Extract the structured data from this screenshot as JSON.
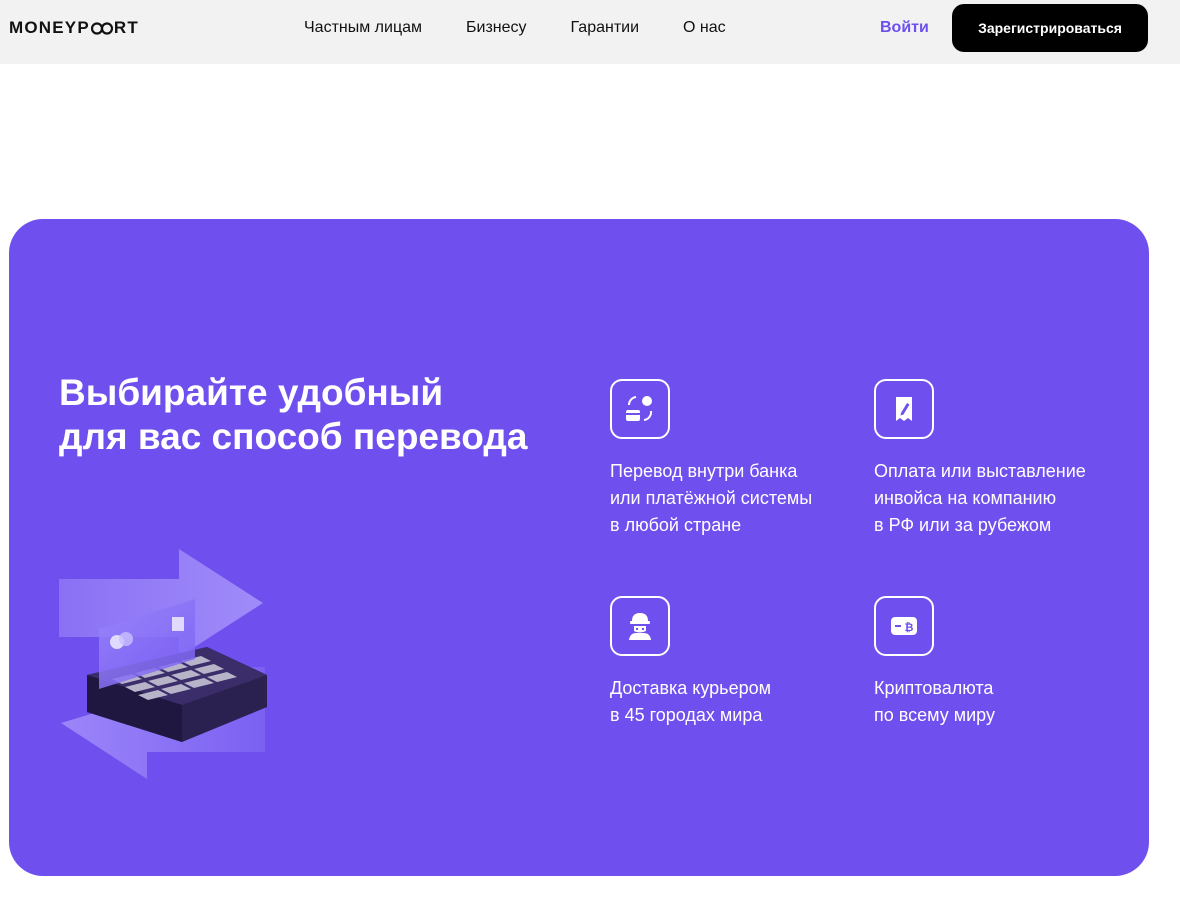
{
  "header": {
    "logo_left": "MONEYP",
    "logo_right": "RT",
    "nav": [
      "Частным лицам",
      "Бизнесу",
      "Гарантии",
      "О нас"
    ],
    "login_label": "Войти",
    "register_label": "Зарегистрироваться"
  },
  "hero": {
    "headline_line1": "Выбирайте удобный",
    "headline_line2": "для вас способ перевода"
  },
  "features": [
    {
      "icon": "bank-transfer-icon",
      "lines": [
        "Перевод внутри банка",
        "или платёжной системы",
        "в любой стране"
      ]
    },
    {
      "icon": "invoice-icon",
      "lines": [
        "Оплата или выставление",
        "инвойса на компанию",
        "в РФ или за рубежом"
      ]
    },
    {
      "icon": "courier-icon",
      "lines": [
        "Доставка курьером",
        "в 45 городах мира"
      ]
    },
    {
      "icon": "crypto-icon",
      "lines": [
        "Криптовалюта",
        "по всему миру"
      ]
    }
  ],
  "colors": {
    "accent": "#6f4fee",
    "login": "#6e4ff0",
    "header_bg": "#f2f2f2",
    "button_bg": "#000000"
  }
}
